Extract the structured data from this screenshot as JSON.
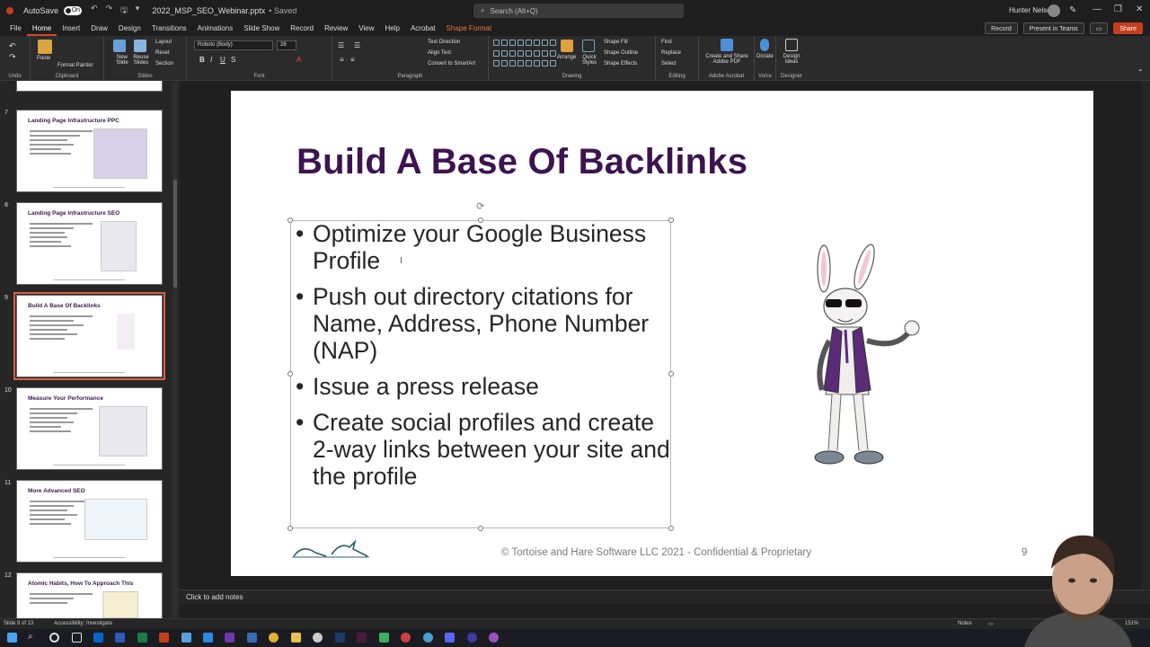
{
  "app": {
    "autosave_label": "AutoSave",
    "autosave_state": "On",
    "filename": "2022_MSP_SEO_Webinar.pptx",
    "saved_state": "• Saved",
    "search_placeholder": "Search (Alt+Q)",
    "user_name": "Hunter Nelson",
    "qat": [
      "↶",
      "↷",
      "🖫",
      "▾"
    ]
  },
  "menu": {
    "tabs": [
      "File",
      "Home",
      "Insert",
      "Draw",
      "Design",
      "Transitions",
      "Animations",
      "Slide Show",
      "Record",
      "Review",
      "View",
      "Help",
      "Acrobat",
      "Shape Format"
    ],
    "active_tab": "Home",
    "record": "Record",
    "present_teams": "Present in Teams",
    "share": "Share"
  },
  "ribbon": {
    "undo": "Undo",
    "clipboard": {
      "paste": "Paste",
      "format_painter": "Format Painter",
      "label": "Clipboard"
    },
    "slides": {
      "new_slide": "New Slide",
      "reuse": "Reuse Slides",
      "layout": "Layout",
      "reset": "Reset",
      "section": "Section",
      "label": "Slides"
    },
    "font": {
      "family": "Roboto (Body)",
      "size": "28",
      "label": "Font"
    },
    "paragraph": {
      "text_direction": "Text Direction",
      "align_text": "Align Text",
      "smartart": "Convert to SmartArt",
      "label": "Paragraph"
    },
    "drawing": {
      "arrange": "Arrange",
      "quick_styles": "Quick Styles",
      "shape_fill": "Shape Fill",
      "shape_outline": "Shape Outline",
      "shape_effects": "Shape Effects",
      "label": "Drawing"
    },
    "editing": {
      "find": "Find",
      "replace": "Replace",
      "select": "Select",
      "label": "Editing"
    },
    "adobe": {
      "create_share": "Create and Share Adobe PDF",
      "label": "Adobe Acrobat"
    },
    "voice": {
      "dictate": "Dictate",
      "label": "Voice"
    },
    "designer": {
      "design_ideas": "Design Ideas",
      "label": "Designer"
    }
  },
  "thumbnails": [
    {
      "num": "7",
      "title": "Landing Page Infrastructure PPC"
    },
    {
      "num": "8",
      "title": "Landing Page Infrastructure SEO"
    },
    {
      "num": "9",
      "title": "Build A Base Of Backlinks",
      "selected": true
    },
    {
      "num": "10",
      "title": "Measure Your Performance"
    },
    {
      "num": "11",
      "title": "More Advanced SEO"
    },
    {
      "num": "12",
      "title": "Atomic Habits, How To Approach This"
    }
  ],
  "slide": {
    "title": "Build A Base Of Backlinks",
    "bullets": [
      "Optimize your Google Business Profile",
      "Push out directory citations for Name, Address, Phone Number (NAP)",
      "Issue a press release",
      "Create social profiles and create 2-way links between your site and the profile"
    ],
    "footer": "© Tortoise and Hare Software LLC 2021 - Confidential & Proprietary",
    "page_number": "9"
  },
  "notes": {
    "placeholder": "Click to add notes"
  },
  "status": {
    "slide_info": "Slide 9 of 13",
    "accessibility": "Accessibility: Investigate",
    "notes_btn": "Notes",
    "zoom": "151%"
  }
}
